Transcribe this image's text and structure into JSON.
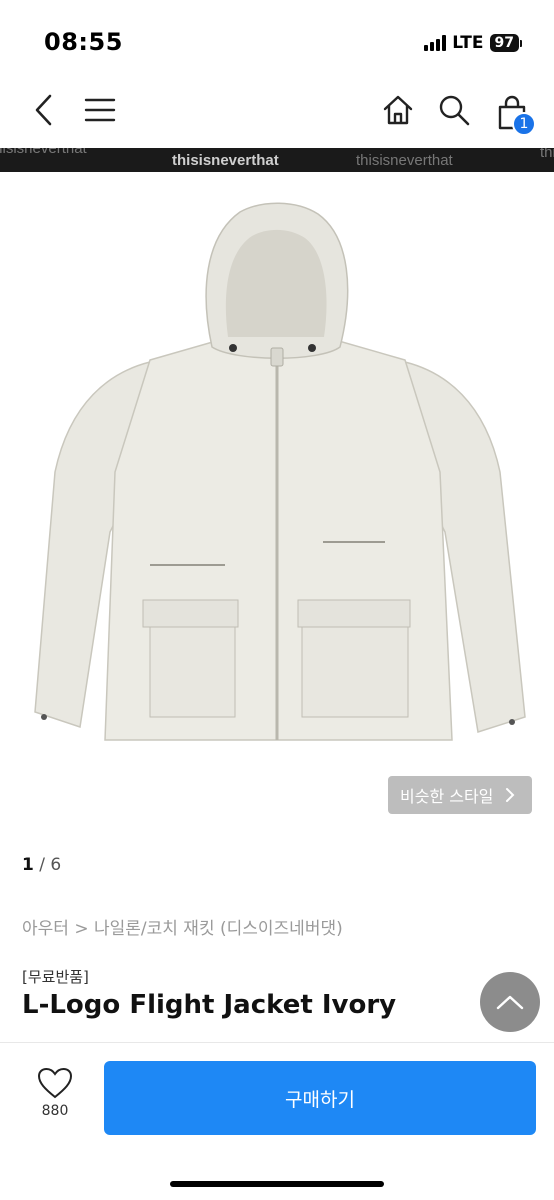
{
  "status_bar": {
    "time": "08:55",
    "network": "LTE",
    "battery": "97"
  },
  "nav": {
    "back_icon": "chevron-left-icon",
    "menu_icon": "hamburger-icon",
    "home_icon": "home-icon",
    "search_icon": "search-icon",
    "cart_icon": "shopping-bag-icon",
    "cart_count": "1"
  },
  "banner": {
    "texts": [
      "thisisneverthat",
      "thisisneverthat",
      "thisisneverthat",
      "thisisneverthat"
    ]
  },
  "gallery": {
    "current": "1",
    "separator": " / ",
    "total": "6",
    "similar_style_label": "비슷한 스타일"
  },
  "product": {
    "breadcrumb": "아우터 > 나일론/코치 재킷 (디스이즈네버댓)",
    "tag": "[무료반품]",
    "title": "L-Logo Flight Jacket Ivory"
  },
  "actions": {
    "like_count": "880",
    "buy_label": "구매하기"
  },
  "colors": {
    "accent": "#1e88f5",
    "badge": "#1a73e8",
    "jacket": "#e9e8e1"
  }
}
